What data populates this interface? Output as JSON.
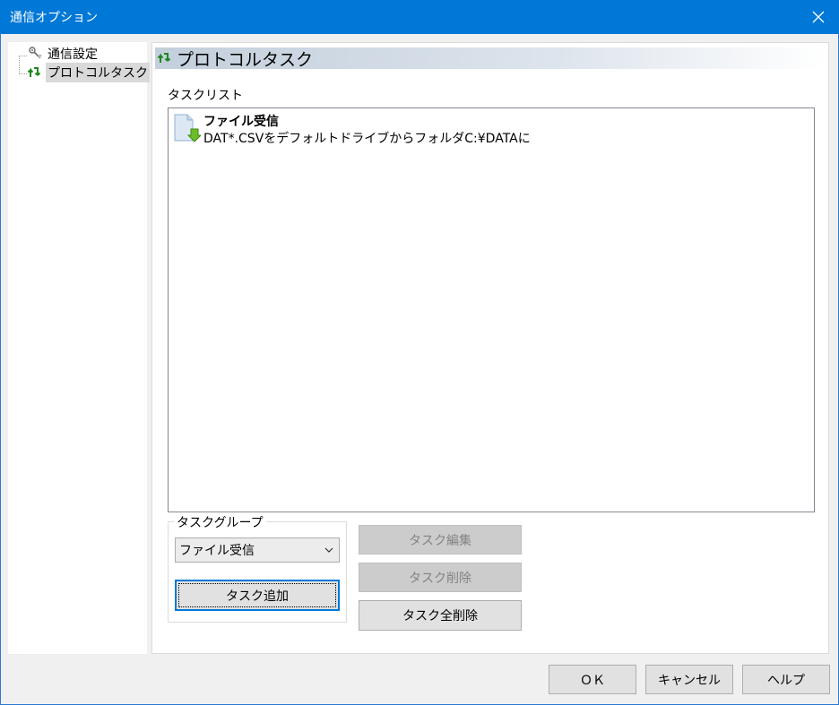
{
  "window": {
    "title": "通信オプション"
  },
  "tree": {
    "items": [
      {
        "label": "通信設定",
        "selected": false
      },
      {
        "label": "プロトコルタスク",
        "selected": true
      }
    ]
  },
  "panel": {
    "header_title": "プロトコルタスク",
    "tasklist_label": "タスクリスト",
    "tasks": [
      {
        "name": "ファイル受信",
        "description": "DAT*.CSVをデフォルトドライブからフォルダC:¥DATAに"
      }
    ],
    "task_group": {
      "legend": "タスクグループ",
      "selected": "ファイル受信",
      "add_button": "タスク追加"
    },
    "buttons": {
      "edit": "タスク編集",
      "delete": "タスク削除",
      "delete_all": "タスク全削除"
    }
  },
  "footer": {
    "ok": "ＯＫ",
    "cancel": "キャンセル",
    "help": "ヘルプ"
  },
  "colors": {
    "titlebar": "#0078d7",
    "header_gradient_start": "#c3cfdc",
    "disabled_button": "#cccccc",
    "default_button_border": "#0078d7"
  }
}
